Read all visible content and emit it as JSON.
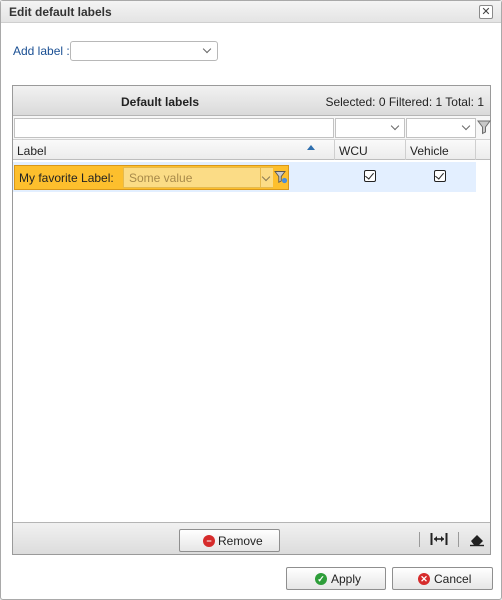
{
  "dialog": {
    "title": "Edit default labels",
    "close_glyph": "✕"
  },
  "add_label": {
    "label": "Add label :",
    "value": ""
  },
  "grid": {
    "title": "Default labels",
    "counts": "Selected: 0 Filtered: 1 Total: 1",
    "columns": [
      {
        "label": "Label",
        "sort": "ascending"
      },
      {
        "label": "WCU"
      },
      {
        "label": "Vehicle"
      }
    ],
    "rows": [
      {
        "label": "My favorite Label:",
        "value_placeholder": "Some value",
        "wcu": true,
        "vehicle": true,
        "highlight_color": "#fdbf2d"
      }
    ],
    "footer": {
      "remove_label": "Remove",
      "remove_icon": "minus-circle-icon",
      "fit_columns_icon": "fit-columns-icon",
      "clear_icon": "eraser-icon"
    }
  },
  "buttons": {
    "apply": "Apply",
    "apply_icon": "check-circle-icon",
    "apply_color": "#2e9e3a",
    "cancel": "Cancel",
    "cancel_icon": "x-circle-icon",
    "cancel_color": "#d62b2b"
  },
  "colors": {
    "selected_row": "#e3efff",
    "link_text": "#1a4f93"
  }
}
